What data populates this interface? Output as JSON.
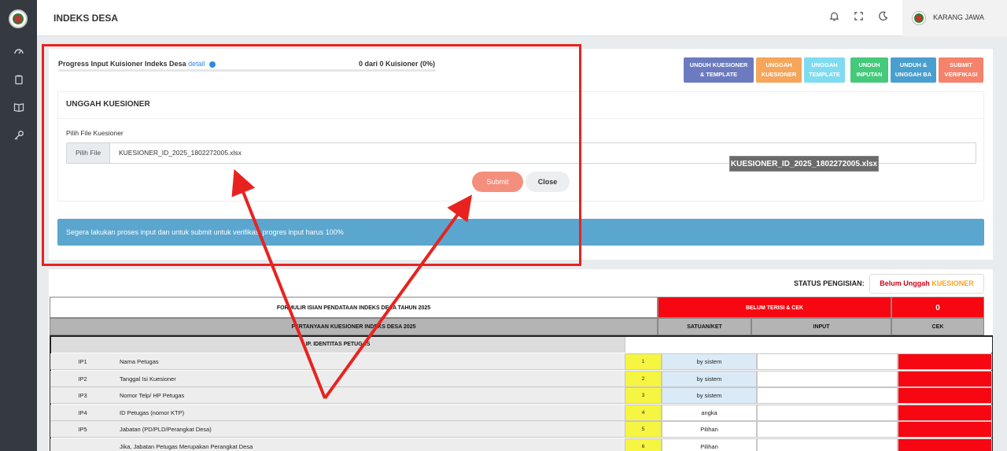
{
  "header": {
    "title": "INDEKS DESA",
    "user_name": "KARANG JAWA",
    "icons": [
      "bell-icon",
      "fullscreen-icon",
      "moon-icon"
    ]
  },
  "sidebar": {
    "icons": [
      "dashboard-icon",
      "clipboard-icon",
      "book-icon",
      "key-icon"
    ]
  },
  "progress": {
    "label": "Progress Input Kuisioner Indeks Desa",
    "detail_link": "detail",
    "count_text": "0 dari 0 Kuisioner (0%)",
    "percent": 0
  },
  "actions": [
    {
      "line1": "UNDUH KUESIONER",
      "line2": "& TEMPLATE",
      "color": "#6c7bbf"
    },
    {
      "line1": "UNGGAH",
      "line2": "KUESIONER",
      "color": "#f5a65b"
    },
    {
      "line1": "UNGGAH",
      "line2": "TEMPLATE",
      "color": "#7fdcf0"
    },
    {
      "line1": "UNDUH",
      "line2": "INPUTAN",
      "color": "#45c97a"
    },
    {
      "line1": "UNDUH &",
      "line2": "UNGGAH BA",
      "color": "#4a9fcf"
    },
    {
      "line1": "SUBMIT",
      "line2": "VERIFIKASI",
      "color": "#f5826a"
    }
  ],
  "upload": {
    "title": "UNGGAH KUESIONER",
    "field_label": "Pilih File Kuesioner",
    "file_button": "Pilih File",
    "file_name": "KUESIONER_ID_2025_1802272005.xlsx",
    "tooltip": "KUESIONER_ID_2025_1802272005.xlsx",
    "submit": "Submit",
    "close": "Close"
  },
  "alert": "Segera lakukan proses input dan untuk submit untuk verifikasi progres input harus 100%",
  "status": {
    "label": "STATUS PENGISIAN:",
    "badge_part1": "Belum Unggah",
    "badge_part2": "KUESIONER"
  },
  "table": {
    "title": "FORMULIR ISIAN PENDATAAN INDEKS DESA TAHUN 2025",
    "belum_terisi": "BELUM TERISI & CEK",
    "belum_count": "0",
    "col_question": "PERTANYAAN KUESIONER INDEKS DESA 2025",
    "col_satuan": "SATUAN/KET",
    "col_input": "INPUT",
    "col_cek": "CEK",
    "section": "IP. IDENTITAS PETUGAS",
    "rows": [
      {
        "code": "IP1",
        "name": "Nama Petugas",
        "num": "1",
        "satuan": "by sistem"
      },
      {
        "code": "IP2",
        "name": "Tanggal Isi Kuesioner",
        "num": "2",
        "satuan": "by sistem"
      },
      {
        "code": "IP3",
        "name": "Nomor Telp/ HP Petugas",
        "num": "3",
        "satuan": "by sistem"
      },
      {
        "code": "IP4",
        "name": "ID Petugas (nomor KTP)",
        "num": "4",
        "satuan": "angka"
      },
      {
        "code": "IP5",
        "name": "Jabatan (PD/PLD/Perangkat Desa)",
        "num": "5",
        "satuan": "Pilihan"
      },
      {
        "code": "",
        "name": "Jika, Jabatan Petugas Merupakan Perangkat Desa",
        "num": "6",
        "satuan": "Pilihan"
      }
    ]
  }
}
